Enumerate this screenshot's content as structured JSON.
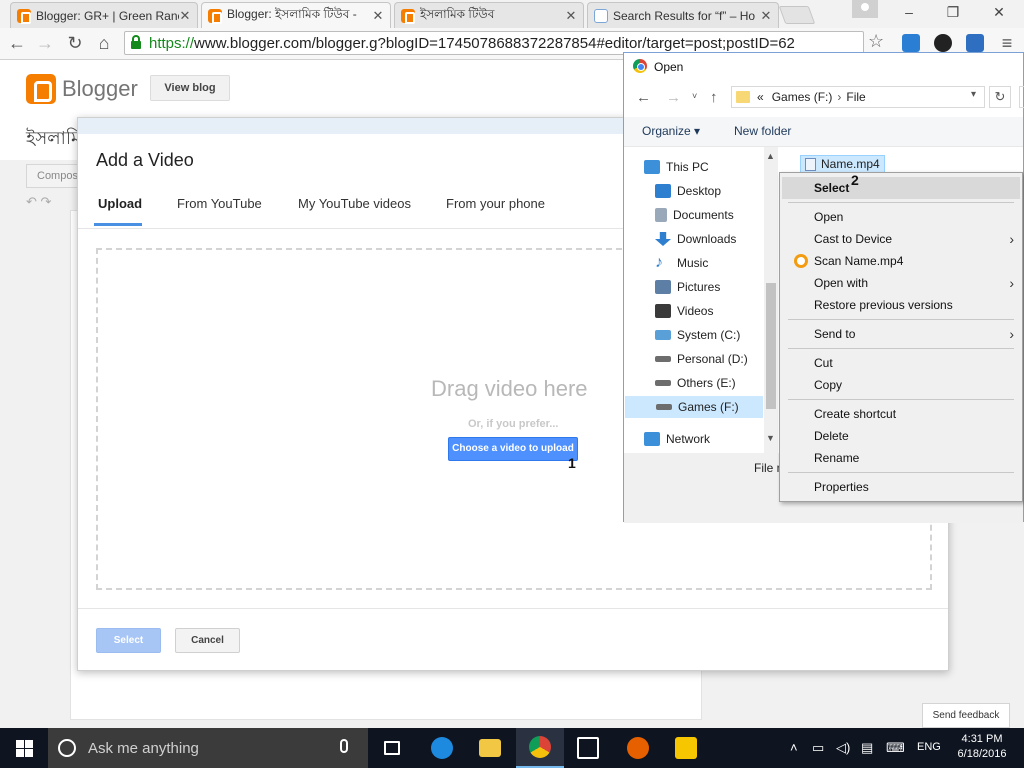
{
  "browser": {
    "tabs": [
      {
        "title": "Blogger: GR+ | Green Ranc",
        "close": "✕"
      },
      {
        "title": "Blogger: ইসলামিক টিউব -",
        "close": "✕"
      },
      {
        "title": "ইসলামিক টিউব",
        "close": "✕"
      },
      {
        "title": "Search Results for “f” – Ho",
        "close": "✕"
      }
    ],
    "url_scheme": "https://",
    "url_rest": "www.blogger.com/blogger.g?blogID=1745078688372287854#editor/target=post;postID=62",
    "window_min": "–",
    "window_max": "❐",
    "window_close": "✕"
  },
  "blogger": {
    "brand": "Blogger",
    "view_blog": "View blog",
    "post_title_fragment": "ইসলামি",
    "compose_fragment": "Compos"
  },
  "video_dialog": {
    "title": "Add a Video",
    "tabs": [
      "Upload",
      "From YouTube",
      "My YouTube videos",
      "From your phone"
    ],
    "drag_text": "Drag video here",
    "or_text": "Or, if you prefer...",
    "choose_button": "Choose a video to upload",
    "select_button": "Select",
    "cancel_button": "Cancel",
    "annotation": "1"
  },
  "open_dialog": {
    "title": "Open",
    "path": [
      "«",
      "Games (F:)",
      "›",
      "File"
    ],
    "organize": "Organize ▾",
    "new_folder": "New folder",
    "nav_items": [
      {
        "label": "This PC",
        "color": "#3c8fd9"
      },
      {
        "label": "Desktop",
        "color": "#2f7fd1"
      },
      {
        "label": "Documents",
        "color": "#9aa9ba"
      },
      {
        "label": "Downloads",
        "color": "#2f7fd1"
      },
      {
        "label": "Music",
        "color": "#2f7fd1"
      },
      {
        "label": "Pictures",
        "color": "#5d7fa6"
      },
      {
        "label": "Videos",
        "color": "#3a3a3a"
      },
      {
        "label": "System (C:)",
        "color": "#5aa0d8"
      },
      {
        "label": "Personal (D:)",
        "color": "#6d6d6d"
      },
      {
        "label": "Others (E:)",
        "color": "#6d6d6d"
      },
      {
        "label": "Games (F:)",
        "color": "#6d6d6d"
      },
      {
        "label": "Network",
        "color": "#3c8fd9"
      }
    ],
    "file": "Name.mp4",
    "filename_label_fragment": "File n"
  },
  "context_menu": {
    "items": [
      "Select",
      "Open",
      "Cast to Device",
      "Scan Name.mp4",
      "Open with",
      "Restore previous versions",
      "Send to",
      "Cut",
      "Copy",
      "Create shortcut",
      "Delete",
      "Rename",
      "Properties"
    ],
    "annotation": "2"
  },
  "feedback": "Send feedback",
  "taskbar": {
    "search_placeholder": "Ask me anything",
    "lang": "ENG",
    "time": "4:31 PM",
    "date": "6/18/2016"
  }
}
